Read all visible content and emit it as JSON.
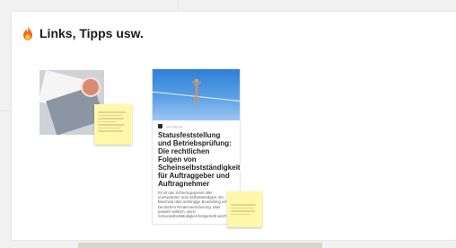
{
  "board": {
    "section_title": "Links, Tipps usw.",
    "title_icon": "fire-icon"
  },
  "image_card": {
    "icon": "document-photo-icon"
  },
  "sticky_note_small": {
    "lines": 9
  },
  "article_card": {
    "source": "www.haufe.de",
    "headline": "Statusfeststellung und Betriebsprüfung: Die rechtlichen Folgen von Scheinselbstständigkeit für Auftraggeber und Auftragnehmer",
    "excerpt": "Es ist das Schreckgespenst aller unerwarteten Solo-Selbstständigen: Ein Bescheid über anhängige Beurteilung von der Deutschen Rentenversicherung. Was passiert wirklich, wenn Scheinselbstständigkeit festgestellt wird?"
  },
  "colors": {
    "sticky": "#fff7a9",
    "frame": "#ffffff",
    "canvas": "#f1f1f1"
  }
}
